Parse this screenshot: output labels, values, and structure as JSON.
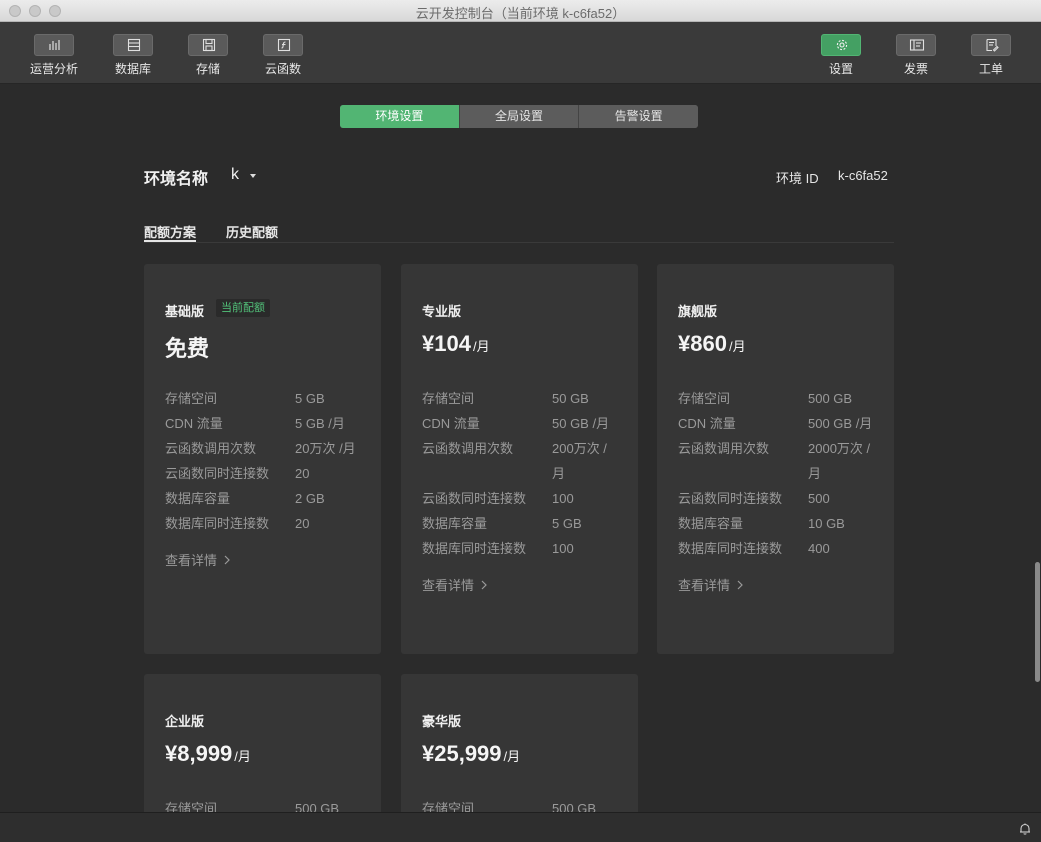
{
  "window": {
    "title": "云开发控制台（当前环境 k-c6fa52）"
  },
  "toolbar": {
    "left": [
      {
        "label": "运营分析",
        "icon": "bar-chart-icon"
      },
      {
        "label": "数据库",
        "icon": "database-icon"
      },
      {
        "label": "存储",
        "icon": "storage-icon"
      },
      {
        "label": "云函数",
        "icon": "function-icon"
      }
    ],
    "right": [
      {
        "label": "设置",
        "icon": "gear-icon",
        "active": true
      },
      {
        "label": "发票",
        "icon": "invoice-icon"
      },
      {
        "label": "工单",
        "icon": "ticket-icon"
      }
    ]
  },
  "tabs": [
    {
      "label": "环境设置",
      "active": true
    },
    {
      "label": "全局设置",
      "active": false
    },
    {
      "label": "告警设置",
      "active": false
    }
  ],
  "env": {
    "name_label": "环境名称",
    "name_value": "k",
    "id_label": "环境 ID",
    "id_value": "k-c6fa52"
  },
  "subtabs": [
    {
      "label": "配额方案",
      "active": true
    },
    {
      "label": "历史配额",
      "active": false
    }
  ],
  "plans": [
    {
      "name": "基础版",
      "badge": "当前配额",
      "price": "免费",
      "unit": "",
      "specs": [
        [
          "存储空间",
          "5 GB"
        ],
        [
          "CDN 流量",
          "5 GB /月"
        ],
        [
          "云函数调用次数",
          "20万次 /月"
        ],
        [
          "云函数同时连接数",
          "20"
        ],
        [
          "数据库容量",
          "2 GB"
        ],
        [
          "数据库同时连接数",
          "20"
        ]
      ],
      "detail": "查看详情"
    },
    {
      "name": "专业版",
      "badge": "",
      "price": "¥104",
      "unit": "/月",
      "specs": [
        [
          "存储空间",
          "50 GB"
        ],
        [
          "CDN 流量",
          "50 GB /月"
        ],
        [
          "云函数调用次数",
          "200万次 /月"
        ],
        [
          "云函数同时连接数",
          "100"
        ],
        [
          "数据库容量",
          "5 GB"
        ],
        [
          "数据库同时连接数",
          "100"
        ]
      ],
      "detail": "查看详情"
    },
    {
      "name": "旗舰版",
      "badge": "",
      "price": "¥860",
      "unit": "/月",
      "specs": [
        [
          "存储空间",
          "500 GB"
        ],
        [
          "CDN 流量",
          "500 GB /月"
        ],
        [
          "云函数调用次数",
          "2000万次 /月"
        ],
        [
          "云函数同时连接数",
          "500"
        ],
        [
          "数据库容量",
          "10 GB"
        ],
        [
          "数据库同时连接数",
          "400"
        ]
      ],
      "detail": "查看详情"
    },
    {
      "name": "企业版",
      "badge": "",
      "price": "¥8,999",
      "unit": "/月",
      "specs": [
        [
          "存储空间",
          "500 GB"
        ]
      ],
      "detail": ""
    },
    {
      "name": "豪华版",
      "badge": "",
      "price": "¥25,999",
      "unit": "/月",
      "specs": [
        [
          "存储空间",
          "500 GB"
        ]
      ],
      "detail": ""
    }
  ],
  "colors": {
    "accent": "#52b573",
    "background": "#2b2b2b",
    "card": "#363636"
  },
  "statusbar": {
    "icon": "bell-icon"
  }
}
